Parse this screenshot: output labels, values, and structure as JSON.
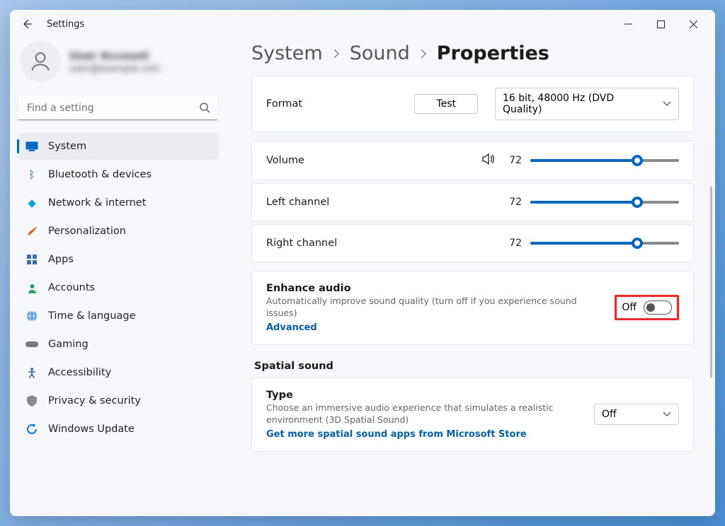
{
  "window": {
    "title": "Settings"
  },
  "profile": {
    "name_placeholder": "User Account",
    "email_placeholder": "user@example.com"
  },
  "search": {
    "placeholder": "Find a setting"
  },
  "nav": [
    {
      "icon": "monitor",
      "label": "System",
      "active": true
    },
    {
      "icon": "bluetooth",
      "label": "Bluetooth & devices"
    },
    {
      "icon": "wifi",
      "label": "Network & internet"
    },
    {
      "icon": "brush",
      "label": "Personalization"
    },
    {
      "icon": "apps",
      "label": "Apps"
    },
    {
      "icon": "person",
      "label": "Accounts"
    },
    {
      "icon": "globe",
      "label": "Time & language"
    },
    {
      "icon": "game",
      "label": "Gaming"
    },
    {
      "icon": "access",
      "label": "Accessibility"
    },
    {
      "icon": "shield",
      "label": "Privacy & security"
    },
    {
      "icon": "update",
      "label": "Windows Update"
    }
  ],
  "breadcrumb": {
    "a": "System",
    "b": "Sound",
    "c": "Properties"
  },
  "format": {
    "label": "Format",
    "test_button": "Test",
    "value": "16 bit, 48000 Hz (DVD Quality)"
  },
  "volume": {
    "label": "Volume",
    "value": "72",
    "percent": 72
  },
  "left_channel": {
    "label": "Left channel",
    "value": "72",
    "percent": 72
  },
  "right_channel": {
    "label": "Right channel",
    "value": "72",
    "percent": 72
  },
  "enhance": {
    "title": "Enhance audio",
    "desc": "Automatically improve sound quality (turn off if you experience sound issues)",
    "link": "Advanced",
    "state_label": "Off"
  },
  "spatial": {
    "section_title": "Spatial sound",
    "type_title": "Type",
    "desc": "Choose an immersive audio experience that simulates a realistic environment (3D Spatial Sound)",
    "link": "Get more spatial sound apps from Microsoft Store",
    "value": "Off"
  }
}
